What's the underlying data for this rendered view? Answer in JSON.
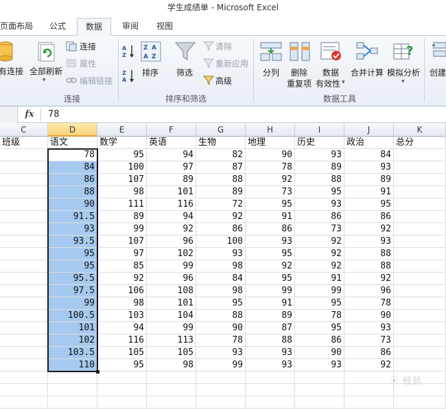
{
  "window": {
    "title": "学生成绩单 - Microsoft Excel"
  },
  "tabs": [
    "页面布局",
    "公式",
    "数据",
    "审阅",
    "视图"
  ],
  "active_tab": "数据",
  "ribbon": {
    "groups": {
      "connections": {
        "label": "连接",
        "existing_connections": "有连接",
        "refresh_all": "全部刷新",
        "connections": "连接",
        "properties": "属性",
        "edit_links": "编辑链接"
      },
      "sort_filter": {
        "label": "排序和筛选",
        "sort": "排序",
        "filter": "筛选",
        "clear": "清除",
        "reapply": "重新应用",
        "advanced": "高级"
      },
      "data_tools": {
        "label": "数据工具",
        "text_to_columns": "分列",
        "remove_duplicates_1": "删除",
        "remove_duplicates_2": "重复项",
        "data_validation_1": "数据",
        "data_validation_2": "有效性",
        "consolidate": "合并计算",
        "what_if": "模拟分析"
      },
      "outline": {
        "create": "创建"
      }
    }
  },
  "formula_bar": {
    "fx_label": "fx",
    "value": "78"
  },
  "columns": [
    "C",
    "D",
    "E",
    "F",
    "G",
    "H",
    "I",
    "J",
    "K"
  ],
  "selected_column": "D",
  "headers": [
    "班级",
    "语文",
    "数学",
    "英语",
    "生物",
    "地理",
    "历史",
    "政治",
    "总分"
  ],
  "rows": [
    [
      "78",
      "95",
      "94",
      "82",
      "90",
      "93",
      "84"
    ],
    [
      "84",
      "100",
      "97",
      "87",
      "78",
      "89",
      "93"
    ],
    [
      "86",
      "107",
      "89",
      "88",
      "92",
      "88",
      "89"
    ],
    [
      "88",
      "98",
      "101",
      "89",
      "73",
      "95",
      "91"
    ],
    [
      "90",
      "111",
      "116",
      "72",
      "95",
      "93",
      "95"
    ],
    [
      "91.5",
      "89",
      "94",
      "92",
      "91",
      "86",
      "86"
    ],
    [
      "93",
      "99",
      "92",
      "86",
      "86",
      "73",
      "92"
    ],
    [
      "93.5",
      "107",
      "96",
      "100",
      "93",
      "92",
      "93"
    ],
    [
      "95",
      "97",
      "102",
      "93",
      "95",
      "92",
      "88"
    ],
    [
      "95",
      "85",
      "99",
      "98",
      "92",
      "92",
      "88"
    ],
    [
      "95.5",
      "92",
      "96",
      "84",
      "95",
      "91",
      "92"
    ],
    [
      "97.5",
      "106",
      "108",
      "98",
      "99",
      "99",
      "96"
    ],
    [
      "99",
      "98",
      "101",
      "95",
      "91",
      "95",
      "78"
    ],
    [
      "100.5",
      "103",
      "104",
      "88",
      "89",
      "78",
      "90"
    ],
    [
      "101",
      "94",
      "99",
      "90",
      "87",
      "95",
      "93"
    ],
    [
      "102",
      "116",
      "113",
      "78",
      "88",
      "86",
      "73"
    ],
    [
      "103.5",
      "105",
      "105",
      "93",
      "93",
      "90",
      "86"
    ],
    [
      "110",
      "95",
      "98",
      "99",
      "93",
      "93",
      "92"
    ]
  ],
  "colors": {
    "selection": "#a6c9ef",
    "accent": "#2b579a"
  }
}
